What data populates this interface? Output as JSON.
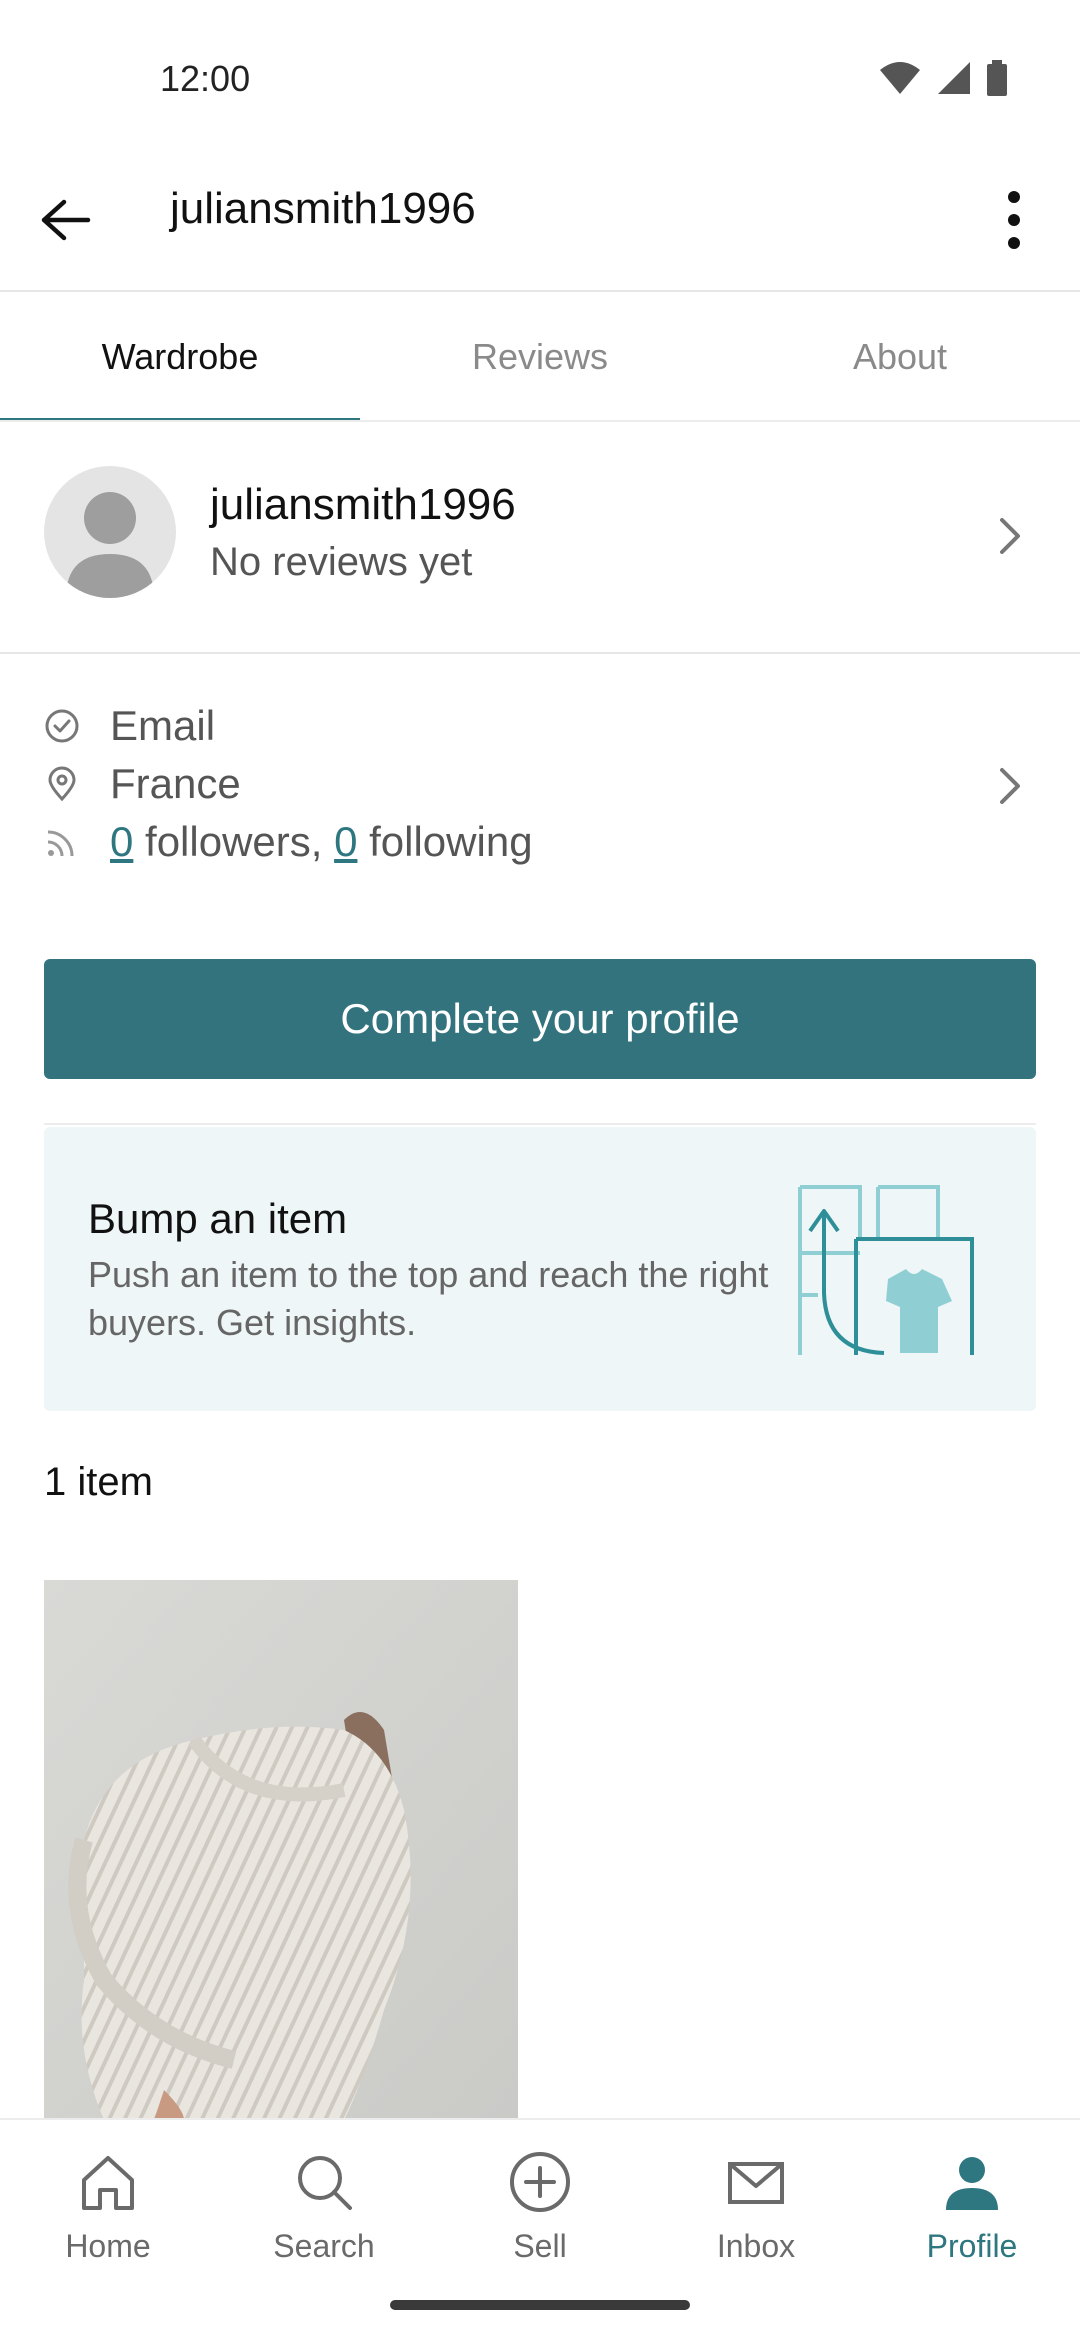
{
  "status_bar": {
    "time": "12:00"
  },
  "app_bar": {
    "title": "juliansmith1996",
    "back_icon": "arrow-left-icon",
    "more_icon": "more-vert-icon"
  },
  "tabs": [
    {
      "label": "Wardrobe",
      "active": true
    },
    {
      "label": "Reviews",
      "active": false
    },
    {
      "label": "About",
      "active": false
    }
  ],
  "profile": {
    "username": "juliansmith1996",
    "reviews_text": "No reviews yet"
  },
  "info": {
    "verified": "Email",
    "location": "France",
    "followers_count": "0",
    "followers_label": " followers, ",
    "following_count": "0",
    "following_label": " following"
  },
  "cta": {
    "label": "Complete your profile"
  },
  "bump": {
    "title": "Bump an item",
    "text": "Push an item to the top and reach the right buyers. Get insights."
  },
  "items": {
    "count_label": "1 item"
  },
  "bottom_nav": [
    {
      "label": "Home",
      "icon": "home-icon",
      "active": false
    },
    {
      "label": "Search",
      "icon": "search-icon",
      "active": false
    },
    {
      "label": "Sell",
      "icon": "plus-circle-icon",
      "active": false
    },
    {
      "label": "Inbox",
      "icon": "mail-icon",
      "active": false
    },
    {
      "label": "Profile",
      "icon": "person-icon",
      "active": true
    }
  ],
  "colors": {
    "accent": "#33737e",
    "bump_bg": "#eef6f7",
    "illustration": "#8fcfd4"
  }
}
